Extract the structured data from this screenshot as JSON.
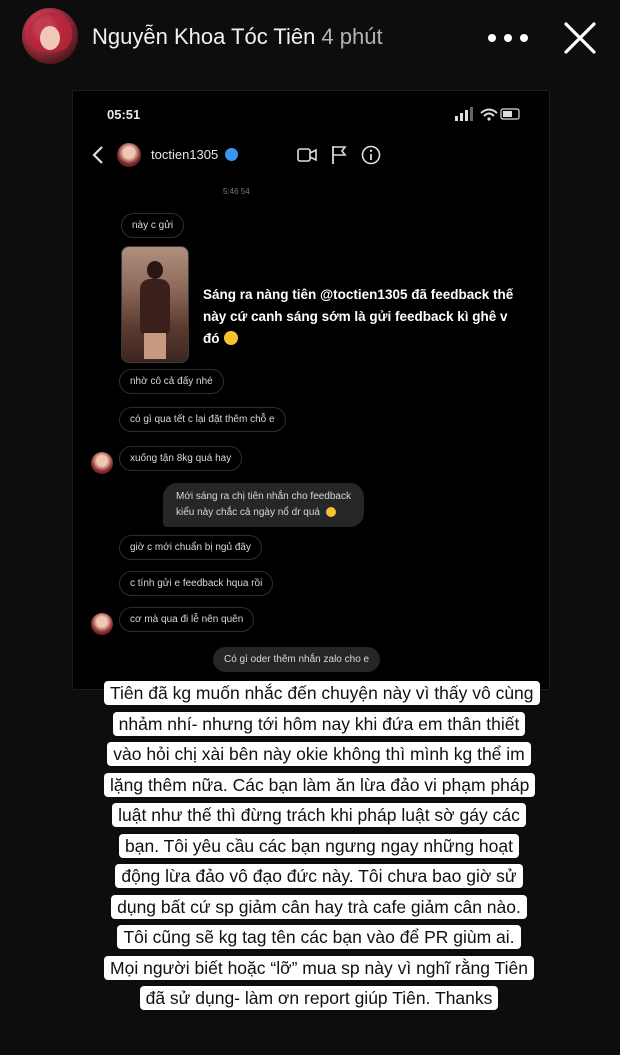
{
  "story": {
    "user_name": "Nguyễn Khoa Tóc Tiên",
    "time_ago": "4 phút"
  },
  "screenshot": {
    "status_time": "05:51",
    "dm_username": "toctien1305",
    "timestamp": "5:46 54",
    "messages": [
      {
        "text": "này c gửi",
        "side": "them"
      },
      {
        "text": "nhờ cô cả đấy nhé",
        "side": "them"
      },
      {
        "text": "có gì qua tết c lại đặt thêm chỗ e",
        "side": "them"
      },
      {
        "text": "xuống tận 8kg quá hay",
        "side": "them"
      },
      {
        "text": "Mới sáng ra chị tiên nhắn cho feedback",
        "side": "me"
      },
      {
        "text": "kiểu này chắc cả ngày nổ dr quá",
        "side": "me"
      },
      {
        "text": "giờ c mới chuẩn bị ngủ đây",
        "side": "them"
      },
      {
        "text": "c tính gửi e feedback hqua rồi",
        "side": "them"
      },
      {
        "text": "cơ mà qua đi lễ nên quên",
        "side": "them"
      },
      {
        "text": "Có gì oder thêm nhắn zalo cho e",
        "side": "me"
      }
    ],
    "caption": "Sáng ra nàng tiên @toctien1305 đã feedback thế này cứ canh sáng sớm là gửi feedback kì ghê v đó"
  },
  "statement": {
    "text": "Tiên đã kg muốn nhắc đến chuyện này vì thấy vô cùng nhảm nhí- nhưng tới hôm nay khi đứa em thân thiết vào hỏi chị xài bên này okie không thì mình kg thể im lặng thêm nữa. Các bạn làm ăn lừa đảo vi phạm pháp luật như thế thì đừng trách khi pháp luật sờ gáy các bạn. Tôi yêu cầu các bạn ngưng ngay những hoạt động lừa đảo vô đạo đức này. Tôi chưa bao giờ sử dụng bất cứ sp giảm cân hay trà cafe giảm cân nào. Tôi cũng sẽ kg tag tên các bạn vào để PR giùm ai. Mọi người biết hoặc “lỡ” mua sp này vì nghĩ rằng Tiên đã sử dụng- làm ơn report giúp Tiên. Thanks"
  }
}
